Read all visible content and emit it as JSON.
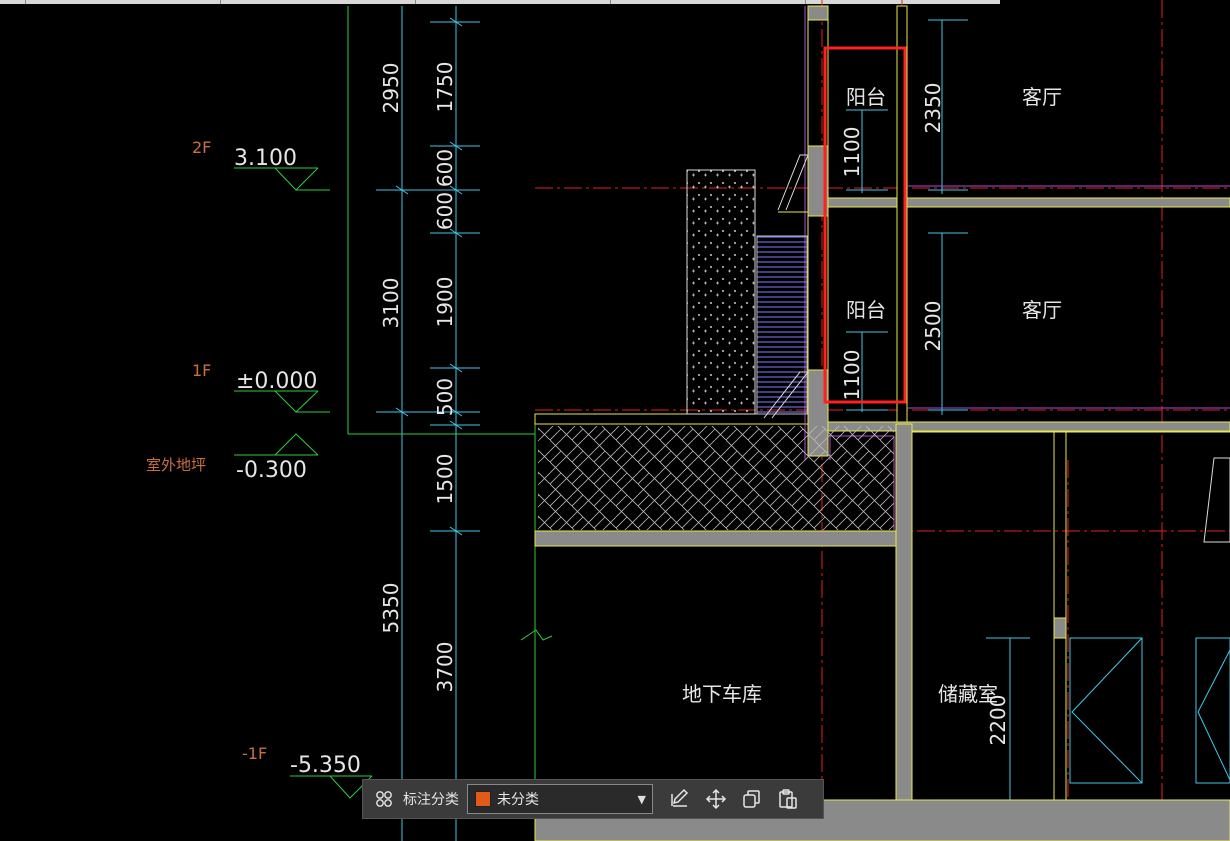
{
  "levels": {
    "f2": {
      "name": "2F",
      "value": "3.100"
    },
    "f1": {
      "name": "1F",
      "value": "±0.000"
    },
    "ground": {
      "name": "室外地坪",
      "value": "-0.300"
    },
    "b1": {
      "name": "-1F",
      "value": "-5.350"
    }
  },
  "dims_outer": [
    "2950",
    "3100",
    "5350"
  ],
  "dims_inner": [
    "1750",
    "600",
    "600",
    "1900",
    "500",
    "1500",
    "3700"
  ],
  "dims_balcony": [
    "1100",
    "1100"
  ],
  "dims_room": [
    "2350",
    "2500",
    "2200"
  ],
  "rooms": {
    "balcony_upper": "阳台",
    "balcony_lower": "阳台",
    "living_upper": "客厅",
    "living_lower": "客厅",
    "garage": "地下车库",
    "storage": "储藏室"
  },
  "toolbar": {
    "category_label": "标注分类",
    "category_value": "未分类",
    "category_color": "#e05a1a"
  },
  "colors": {
    "dimension": "#3fc9e8",
    "level_text": "#c87040",
    "grid_axis": "#e02020",
    "wall": "#e8e84a",
    "highlight": "#ff2020"
  }
}
